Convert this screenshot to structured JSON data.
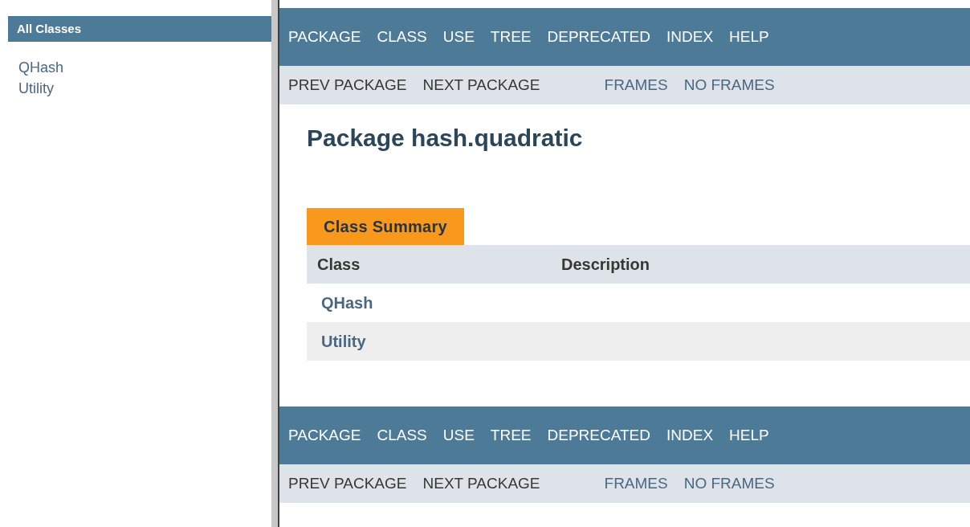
{
  "left_frame": {
    "heading": "All Classes",
    "classes": [
      "QHash",
      "Utility"
    ]
  },
  "top_nav": {
    "items": [
      "PACKAGE",
      "CLASS",
      "USE",
      "TREE",
      "DEPRECATED",
      "INDEX",
      "HELP"
    ],
    "sub_items": [
      "PREV PACKAGE",
      "NEXT PACKAGE"
    ],
    "frame_items": [
      "FRAMES",
      "NO FRAMES"
    ]
  },
  "title": "Package hash.quadratic",
  "summary": {
    "tab": "Class Summary",
    "columns": [
      "Class",
      "Description"
    ],
    "rows": [
      {
        "class": "QHash"
      },
      {
        "class": "Utility"
      }
    ]
  },
  "bottom_nav": {
    "items": [
      "PACKAGE",
      "CLASS",
      "USE",
      "TREE",
      "DEPRECATED",
      "INDEX",
      "HELP"
    ],
    "sub_items": [
      "PREV PACKAGE",
      "NEXT PACKAGE"
    ],
    "frame_items": [
      "FRAMES",
      "NO FRAMES"
    ]
  }
}
